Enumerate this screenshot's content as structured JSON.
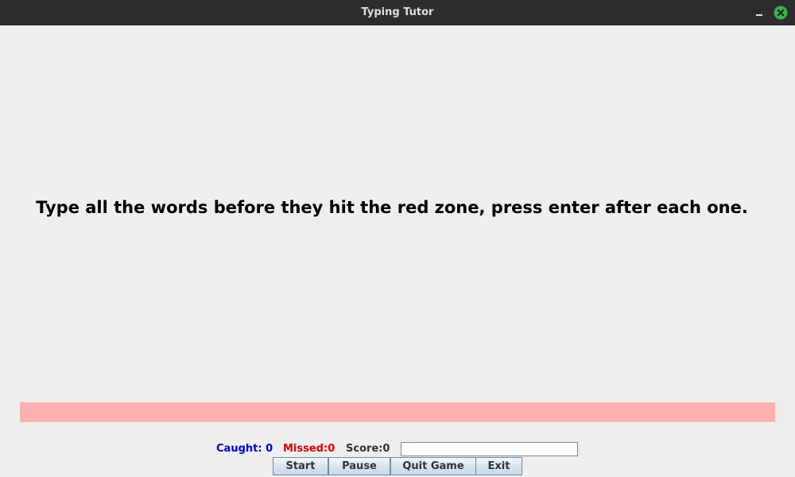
{
  "window": {
    "title": "Typing Tutor",
    "close_icon": "close-icon",
    "minimize_icon": "minimize-icon",
    "close_color": "#3bb24a"
  },
  "game": {
    "instruction": "Type all the words before they hit the red zone, press enter after each one.",
    "red_zone_color": "#ffb0b0"
  },
  "status": {
    "caught": "Caught: 0",
    "missed": "Missed:0",
    "score": "Score:0",
    "caught_color": "#0000cc",
    "missed_color": "#dd0000",
    "input_value": ""
  },
  "buttons": {
    "start": "Start",
    "pause": "Pause",
    "quit": "Quit Game",
    "exit": "Exit"
  }
}
